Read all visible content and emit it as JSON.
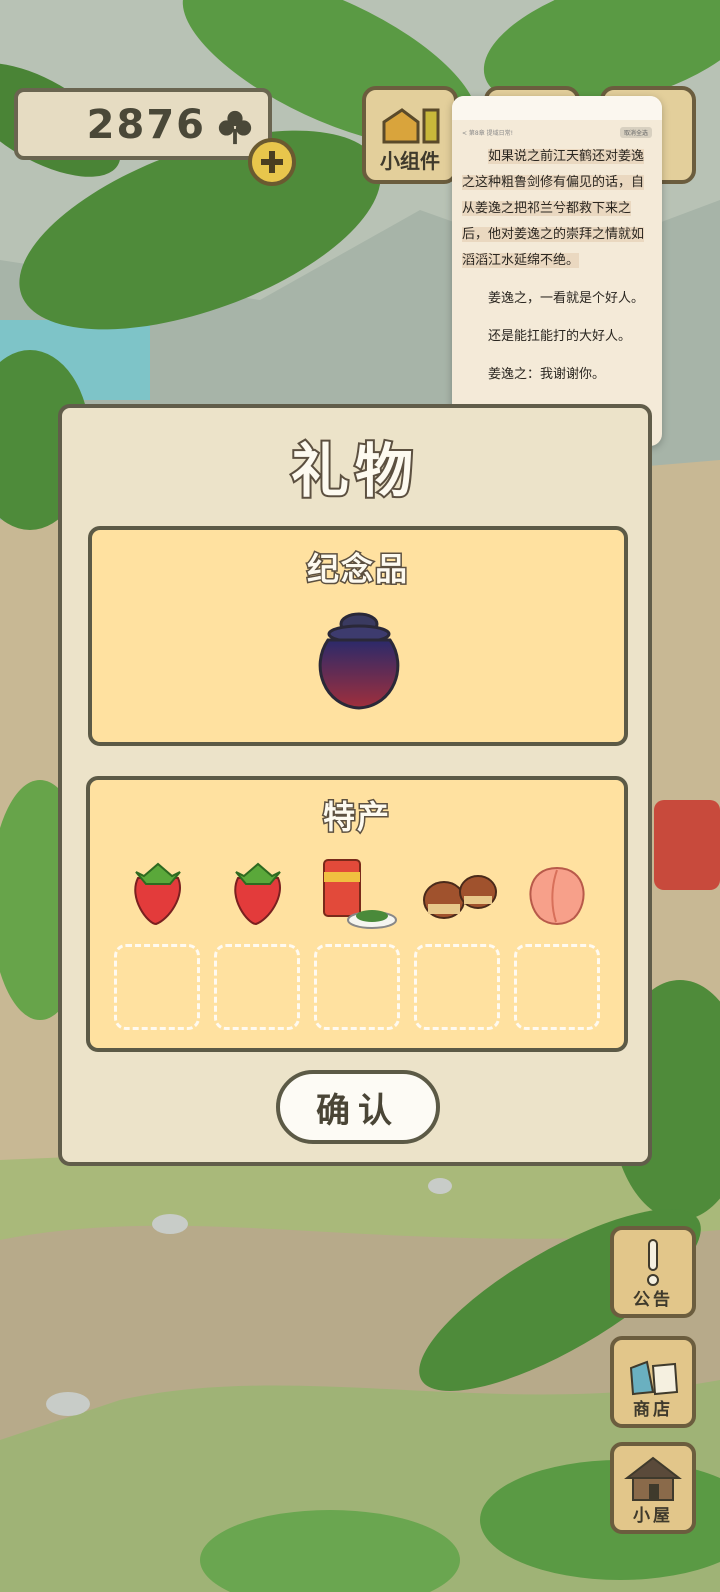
{
  "currency": {
    "amount": "2876",
    "icon": "clover-icon"
  },
  "top_buttons": [
    {
      "label": "小组件",
      "icon": "widget-icon"
    },
    {
      "label": "",
      "icon": "hidden-icon"
    },
    {
      "label": "",
      "icon": "hidden-icon"
    }
  ],
  "reader": {
    "nav_left": "< 第8章 提域日常!",
    "nav_chip": "取消全选",
    "paragraphs": [
      "如果说之前江天鹤还对姜逸之这种粗鲁剑修有偏见的话，自从姜逸之把祁兰兮都救下来之后，他对姜逸之的崇拜之情就如滔滔江水延绵不绝。",
      "姜逸之，一看就是个好人。",
      "还是能扛能打的大好人。",
      "姜逸之：我谢谢你。"
    ]
  },
  "dialog": {
    "title": "礼物",
    "souvenir": {
      "title": "纪念品",
      "item": "jar"
    },
    "specialty": {
      "title": "特产",
      "items": [
        "strawberry",
        "strawberry",
        "tea-can",
        "chestnut",
        "peach"
      ],
      "empty_slots": 5
    },
    "confirm_label": "确认"
  },
  "side_buttons": [
    {
      "label": "公告",
      "icon": "exclamation-icon"
    },
    {
      "label": "商店",
      "icon": "shop-bag-icon"
    },
    {
      "label": "小屋",
      "icon": "house-icon"
    }
  ],
  "colors": {
    "panel": "#ffe1a0",
    "dialog": "#ece3c9",
    "border": "#5c5a46",
    "button_wood": "#e2c68a"
  }
}
